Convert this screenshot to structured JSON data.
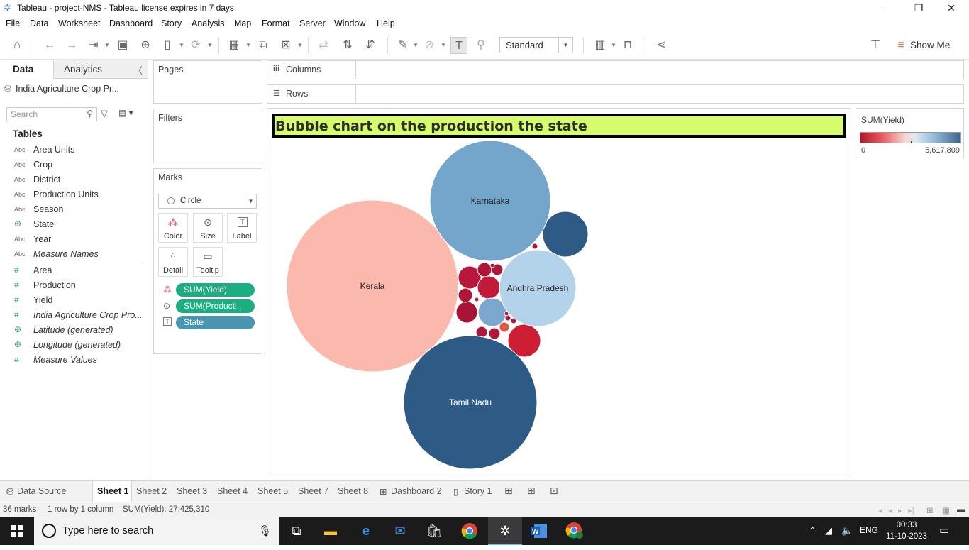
{
  "window": {
    "title": "Tableau - project-NMS - Tableau license expires in 7 days",
    "controls": [
      "minimize",
      "restore",
      "close"
    ]
  },
  "menu": [
    "File",
    "Data",
    "Worksheet",
    "Dashboard",
    "Story",
    "Analysis",
    "Map",
    "Format",
    "Server",
    "Window",
    "Help"
  ],
  "toolbar": {
    "fit_select": "Standard",
    "show_me_label": "Show Me"
  },
  "left_pane": {
    "tab_data": "Data",
    "tab_analytics": "Analytics",
    "datasource": "India Agriculture Crop Pr...",
    "search_placeholder": "Search",
    "tables_heading": "Tables",
    "dimensions": [
      {
        "name": "Area Units",
        "type": "Abc"
      },
      {
        "name": "Crop",
        "type": "Abc"
      },
      {
        "name": "District",
        "type": "Abc"
      },
      {
        "name": "Production Units",
        "type": "Abc"
      },
      {
        "name": "Season",
        "type": "Abc"
      },
      {
        "name": "State",
        "type": "geo"
      },
      {
        "name": "Year",
        "type": "Abc"
      },
      {
        "name": "Measure Names",
        "type": "Abc"
      }
    ],
    "measures": [
      {
        "name": "Area",
        "type": "#"
      },
      {
        "name": "Production",
        "type": "#"
      },
      {
        "name": "Yield",
        "type": "#"
      },
      {
        "name": "India Agriculture Crop Pro...",
        "type": "#"
      },
      {
        "name": "Latitude (generated)",
        "type": "geo"
      },
      {
        "name": "Longitude (generated)",
        "type": "geo"
      },
      {
        "name": "Measure Values",
        "type": "#"
      }
    ]
  },
  "cards": {
    "pages": "Pages",
    "filters": "Filters",
    "marks": "Marks",
    "mark_type": "Circle",
    "mark_buttons": [
      "Color",
      "Size",
      "Label",
      "Detail",
      "Tooltip"
    ],
    "pills": [
      {
        "label": "SUM(Yield)",
        "color": "#1cad80",
        "icon": "color-icon"
      },
      {
        "label": "SUM(Producti..",
        "color": "#1cad80",
        "icon": "size-icon"
      },
      {
        "label": "State",
        "color": "#4996b2",
        "icon": "label-icon"
      }
    ]
  },
  "shelves": {
    "columns": "Columns",
    "rows": "Rows"
  },
  "viz": {
    "title": "Bubble chart on the production the state"
  },
  "legend": {
    "title": "SUM(Yield)",
    "min": "0",
    "max": "5,617,809"
  },
  "chart_data": {
    "type": "bubble",
    "title": "Bubble chart on the production the state",
    "size_measure": "SUM(Production)",
    "color_measure": "SUM(Yield)",
    "color_range": [
      0,
      5617809
    ],
    "labeled_bubbles": [
      {
        "state": "Kerala",
        "color": "#fbb8ac"
      },
      {
        "state": "Tamil Nadu",
        "color": "#2e5a86"
      },
      {
        "state": "Karnataka",
        "color": "#74a5cb"
      },
      {
        "state": "Andhra Pradesh",
        "color": "#b3d3ea"
      }
    ],
    "mark_count": 36
  },
  "sheet_tabs": {
    "data_source": "Data Source",
    "sheets": [
      "Sheet 1",
      "Sheet 2",
      "Sheet 3",
      "Sheet 4",
      "Sheet 5",
      "Sheet 7",
      "Sheet 8",
      "Dashboard 2",
      "Story 1"
    ],
    "active": "Sheet 1"
  },
  "status": {
    "marks": "36 marks",
    "layout": "1 row by 1 column",
    "sum": "SUM(Yield): 27,425,310"
  },
  "taskbar": {
    "search_placeholder": "Type here to search",
    "language": "ENG",
    "time": "00:33",
    "date": "11-10-2023"
  }
}
